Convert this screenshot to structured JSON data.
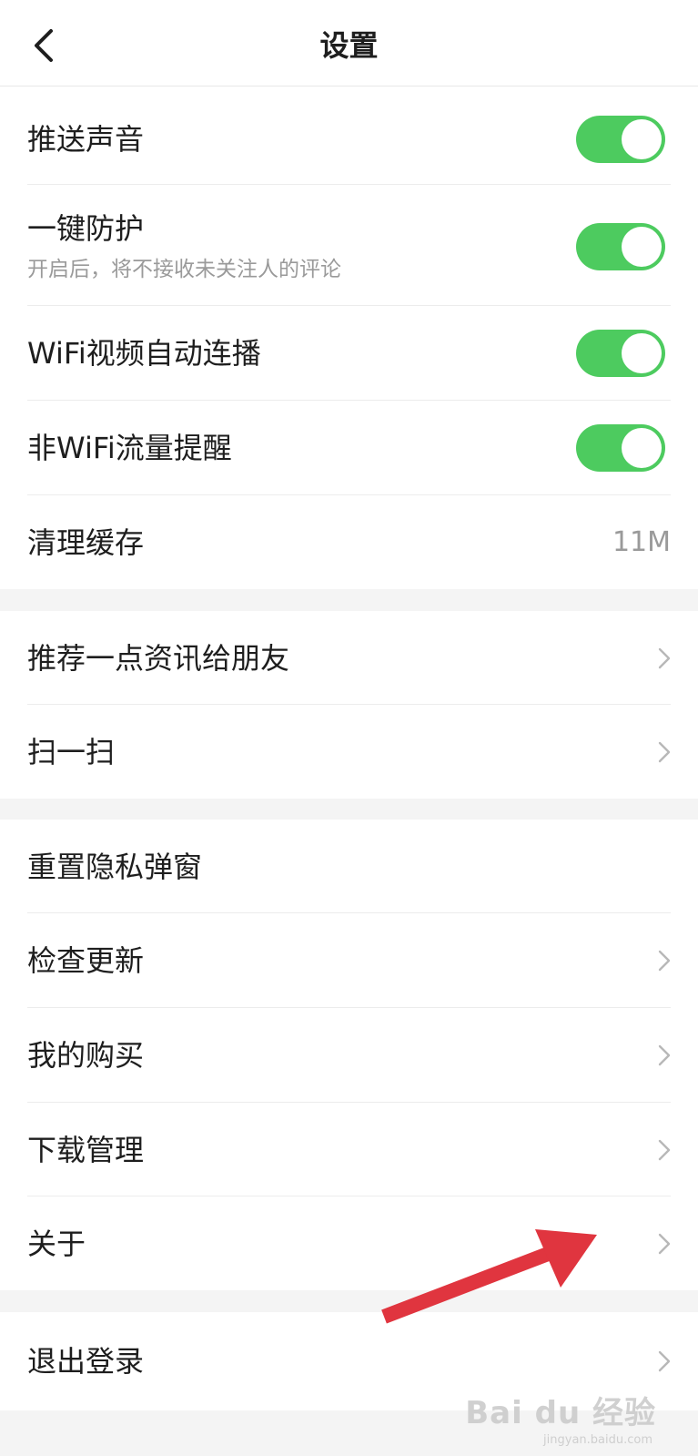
{
  "header": {
    "title": "设置",
    "back_icon": "chevron-left-icon"
  },
  "settings": {
    "push_sound": {
      "label": "推送声音",
      "enabled": true
    },
    "one_key_protect": {
      "label": "一键防护",
      "description": "开启后，将不接收未关注人的评论",
      "enabled": true
    },
    "wifi_autoplay": {
      "label": "WiFi视频自动连播",
      "enabled": true
    },
    "non_wifi_alert": {
      "label": "非WiFi流量提醒",
      "enabled": true
    },
    "clear_cache": {
      "label": "清理缓存",
      "value": "11M"
    },
    "recommend": {
      "label": "推荐一点资讯给朋友"
    },
    "scan": {
      "label": "扫一扫"
    },
    "reset_privacy": {
      "label": "重置隐私弹窗"
    },
    "check_update": {
      "label": "检查更新"
    },
    "my_purchases": {
      "label": "我的购买"
    },
    "download_manage": {
      "label": "下载管理"
    },
    "about": {
      "label": "关于"
    },
    "logout": {
      "label": "退出登录"
    }
  },
  "colors": {
    "toggle_on": "#4dcb5f",
    "annotation_arrow": "#e0353f",
    "background": "#f4f4f4"
  },
  "watermark": {
    "text": "Bai du 经验",
    "subtext": "jingyan.baidu.com"
  }
}
